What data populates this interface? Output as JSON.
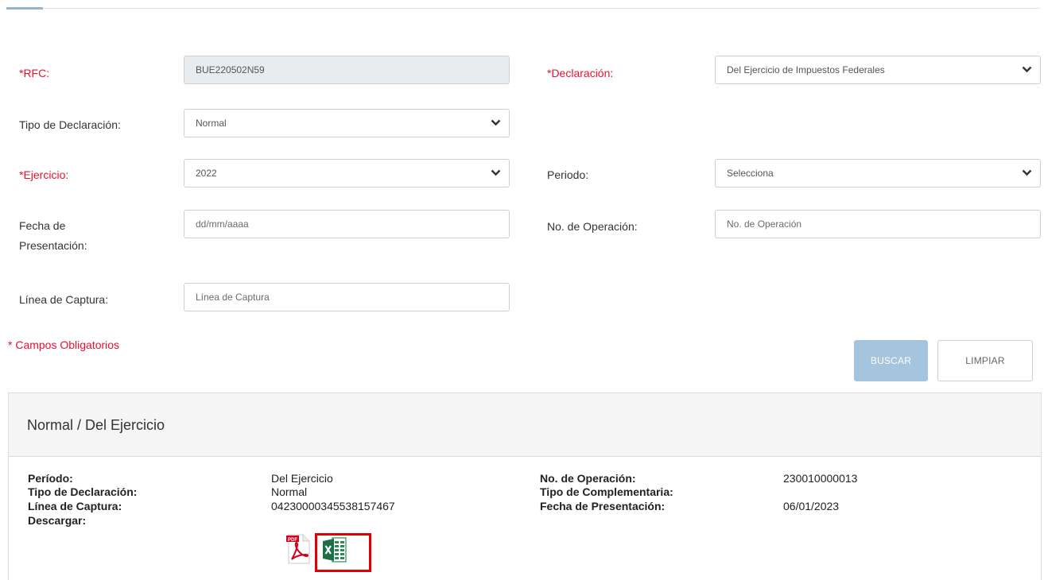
{
  "form": {
    "rfc": {
      "label": "*RFC:",
      "value": "BUE220502N59"
    },
    "declaracion": {
      "label": "*Declaración:",
      "value": "Del Ejercicio de Impuestos Federales"
    },
    "tipo_declaracion": {
      "label": "Tipo de Declaración:",
      "value": "Normal"
    },
    "ejercicio": {
      "label": "*Ejercicio:",
      "value": "2022"
    },
    "periodo": {
      "label": "Periodo:",
      "value": "Selecciona"
    },
    "fecha_presentacion": {
      "label_line1": "Fecha de",
      "label_line2": "Presentación:",
      "placeholder": "dd/mm/aaaa"
    },
    "no_operacion": {
      "label": "No. de Operación:",
      "placeholder": "No. de Operación"
    },
    "linea_captura": {
      "label": "Línea de Captura:",
      "placeholder": "Línea de Captura"
    },
    "required_note": "* Campos Obligatorios"
  },
  "buttons": {
    "search": "BUSCAR",
    "clear": "LIMPIAR"
  },
  "result": {
    "title": "Normal / Del Ejercicio",
    "periodo_label": "Período:",
    "periodo_value": "Del Ejercicio",
    "tipo_label": "Tipo de Declaración:",
    "tipo_value": "Normal",
    "linea_label": "Línea de Captura:",
    "linea_value": "0423000034553815746​7",
    "descargar_label": "Descargar:",
    "operacion_label": "No. de Operación:",
    "operacion_value": "230010000013",
    "complementaria_label": "Tipo de Complementaria:",
    "fecha_label": "Fecha de Presentación:",
    "fecha_value": "06/01/2023",
    "icons": [
      "pdf-icon",
      "excel-icon"
    ]
  },
  "colors": {
    "required": "#e8112d",
    "primary_disabled": "#a5c4dd",
    "highlight": "#e00000"
  }
}
